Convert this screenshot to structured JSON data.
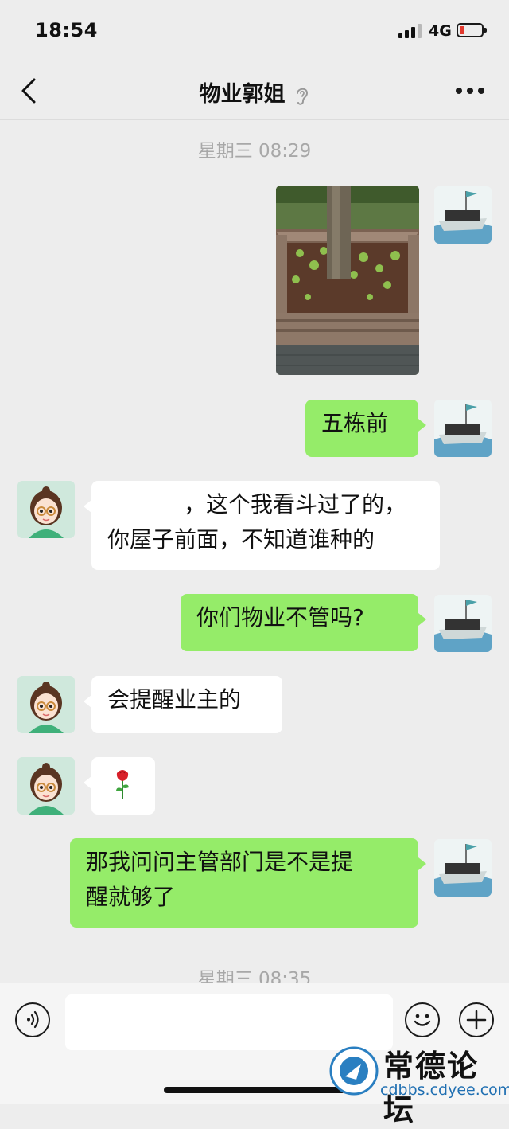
{
  "status_bar": {
    "time": "18:54",
    "network": "4G"
  },
  "header": {
    "title": "物业郭姐"
  },
  "timestamps": [
    "星期三 08:29",
    "星期三 08:35"
  ],
  "messages": [
    {
      "from": "me",
      "type": "image"
    },
    {
      "from": "me",
      "type": "text",
      "lines": [
        "五栋前"
      ]
    },
    {
      "from": "them",
      "type": "text",
      "lines": [
        "，这个我看斗过了的，",
        "你屋子前面，不知道谁种的"
      ]
    },
    {
      "from": "me",
      "type": "text",
      "lines": [
        "你们物业不管吗?"
      ]
    },
    {
      "from": "them",
      "type": "text",
      "lines": [
        "会提醒业主的"
      ]
    },
    {
      "from": "them",
      "type": "emoji",
      "emoji": "🌹"
    },
    {
      "from": "me",
      "type": "text",
      "lines": [
        "那我问问主管部门是不是提",
        "醒就够了"
      ]
    }
  ],
  "input": {
    "placeholder": ""
  },
  "watermark": {
    "text": "常德论坛",
    "url": "cdbbs.cdyee.com",
    "logo_text": "常德论坛 cdbbs.cdyee.com"
  },
  "colors": {
    "background": "#ededed",
    "my_bubble": "#95ec69",
    "their_bubble": "#ffffff",
    "timestamp": "#a8a8a8"
  }
}
